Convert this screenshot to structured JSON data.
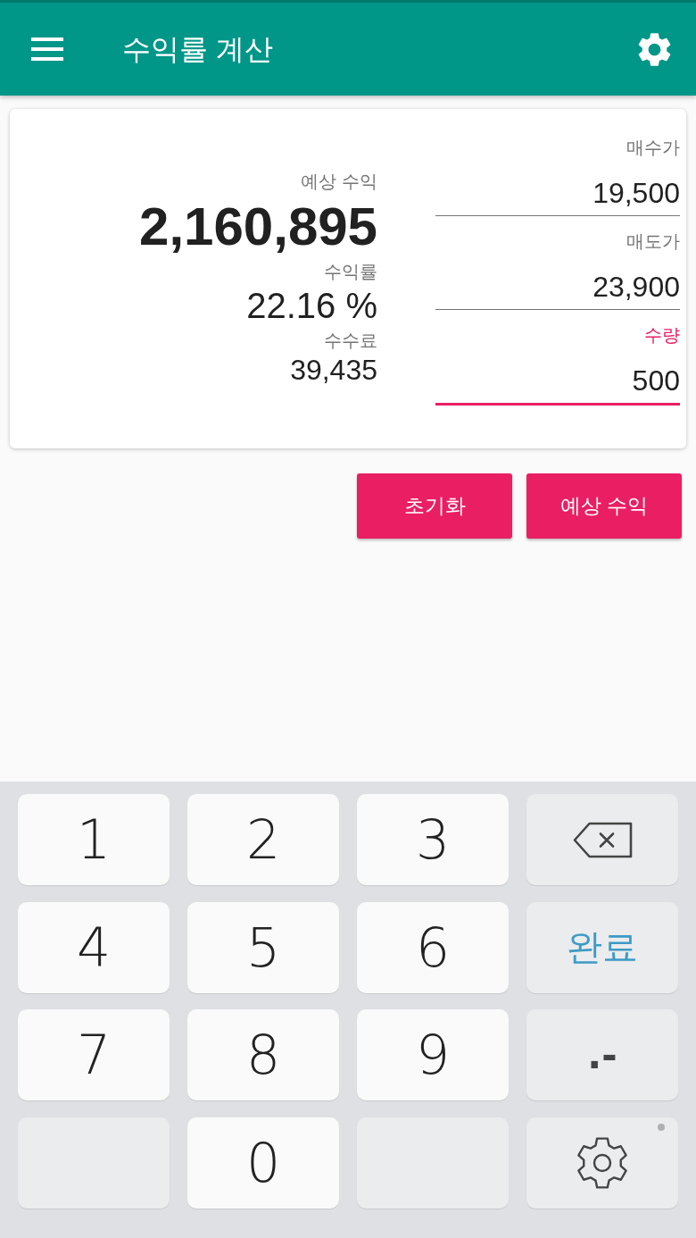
{
  "toolbar": {
    "title": "수익률 계산"
  },
  "results": [
    {
      "kind": "primary",
      "label": "예상 수익",
      "value": "2,160,895"
    },
    {
      "kind": "secondary",
      "label": "수익률",
      "value": "22.16 %"
    },
    {
      "kind": "small",
      "label": "수수료",
      "value": "39,435"
    }
  ],
  "fields": [
    {
      "label": "매수가",
      "value": "19,500",
      "focused": false
    },
    {
      "label": "매도가",
      "value": "23,900",
      "focused": false
    },
    {
      "label": "수량",
      "value": "500",
      "focused": true
    }
  ],
  "buttons": [
    {
      "label": "초기화"
    },
    {
      "label": "예상 수익"
    }
  ],
  "keypad": {
    "rows": [
      [
        {
          "kind": "digit",
          "label": "1"
        },
        {
          "kind": "digit",
          "label": "2"
        },
        {
          "kind": "digit",
          "label": "3"
        },
        {
          "kind": "backspace"
        }
      ],
      [
        {
          "kind": "digit",
          "label": "4"
        },
        {
          "kind": "digit",
          "label": "5"
        },
        {
          "kind": "digit",
          "label": "6"
        },
        {
          "kind": "done",
          "label": "완료"
        }
      ],
      [
        {
          "kind": "digit",
          "label": "7"
        },
        {
          "kind": "digit",
          "label": "8"
        },
        {
          "kind": "digit",
          "label": "9"
        },
        {
          "kind": "symbol",
          "label": ".-"
        }
      ],
      [
        {
          "kind": "blank"
        },
        {
          "kind": "digit",
          "label": "0"
        },
        {
          "kind": "blank"
        },
        {
          "kind": "settings"
        }
      ]
    ]
  }
}
